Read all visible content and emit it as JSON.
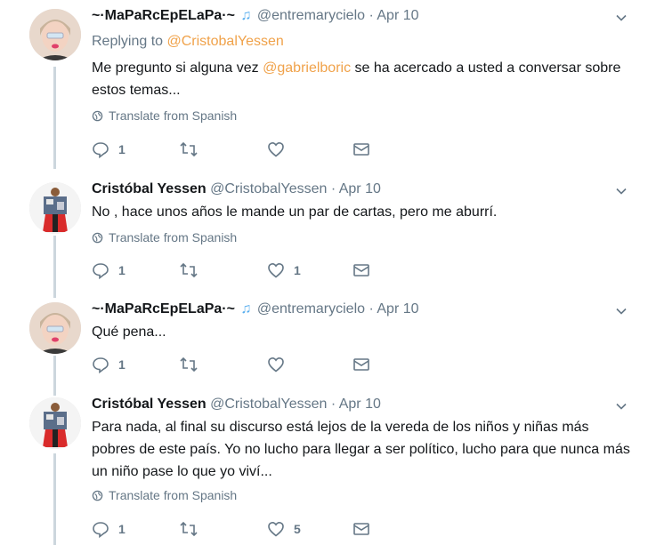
{
  "tweets": [
    {
      "name": "~·MaPaRcEpELaPa·~",
      "emoji": "♫",
      "handle": "@entremarycielo",
      "sep": "·",
      "date": "Apr 10",
      "replying_prefix": "Replying to",
      "replying_to": "@CristobalYessen",
      "text_before": "Me pregunto si alguna vez ",
      "mention": "@gabrielboric",
      "text_after": " se ha acercado a usted a conversar sobre estos temas...",
      "translate": "Translate from Spanish",
      "replies": "1",
      "retweets": "",
      "likes": ""
    },
    {
      "name": "Cristóbal Yessen",
      "handle": "@CristobalYessen",
      "sep": "·",
      "date": "Apr 10",
      "text": "No , hace unos años le mande un par de cartas, pero me aburrí.",
      "translate": "Translate from Spanish",
      "replies": "1",
      "retweets": "",
      "likes": "1"
    },
    {
      "name": "~·MaPaRcEpELaPa·~",
      "emoji": "♫",
      "handle": "@entremarycielo",
      "sep": "·",
      "date": "Apr 10",
      "text": "Qué pena...",
      "replies": "1",
      "retweets": "",
      "likes": ""
    },
    {
      "name": "Cristóbal Yessen",
      "handle": "@CristobalYessen",
      "sep": "·",
      "date": "Apr 10",
      "text": "Para nada, al final su discurso está lejos de la vereda de los niños y niñas más pobres de este país. Yo no lucho para llegar a ser político, lucho para que nunca más un niño pase lo que yo viví...",
      "translate": "Translate from Spanish",
      "replies": "1",
      "retweets": "",
      "likes": "5"
    }
  ],
  "icons": {
    "reply": "reply-icon",
    "retweet": "retweet-icon",
    "like": "heart-icon",
    "dm": "envelope-icon",
    "translate": "globe-icon",
    "caret": "chevron-down-icon"
  },
  "colors": {
    "link": "#f0a24a",
    "secondary": "#657786",
    "thread_line": "#ccd6dd"
  }
}
